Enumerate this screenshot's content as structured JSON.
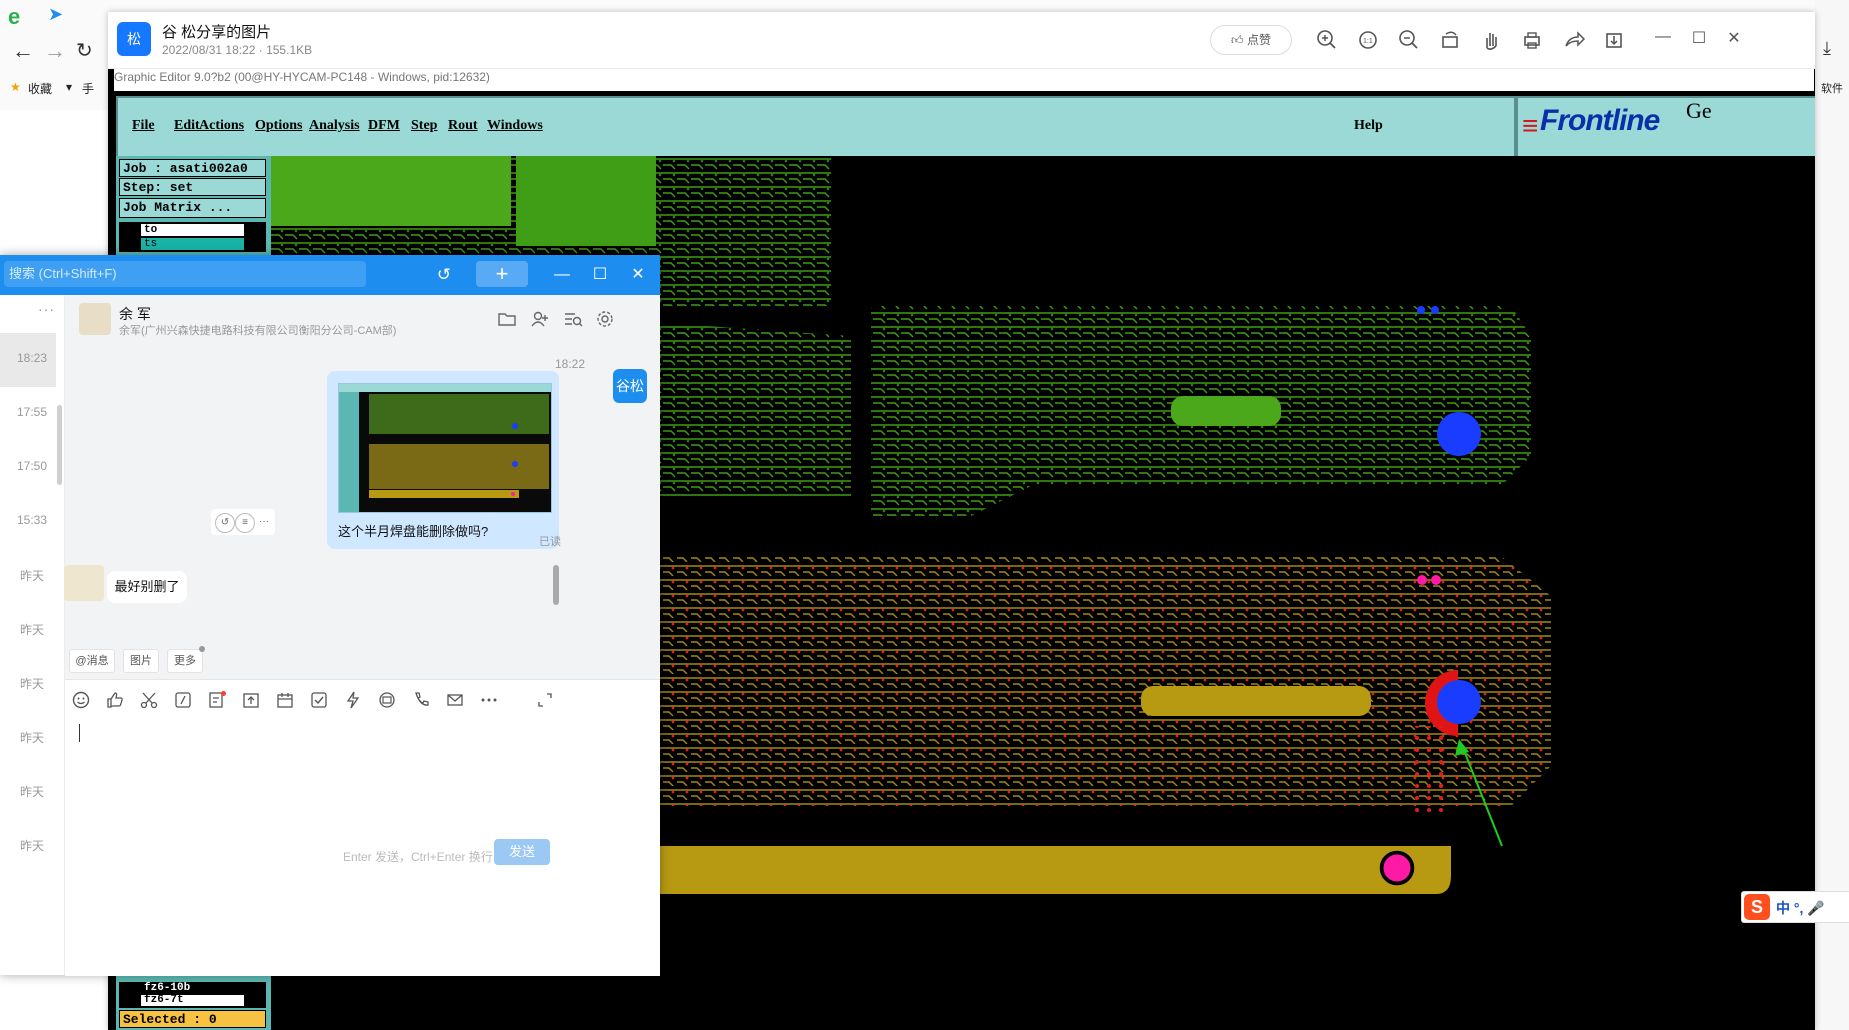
{
  "browser": {
    "bookmark_favorites": "收藏",
    "bookmark_mobile": "手",
    "right_label": "软件"
  },
  "viewer": {
    "avatar_char": "松",
    "title": "谷 松分享的图片",
    "subtitle": "2022/08/31 18:22 · 155.1KB",
    "like_label": "点赞",
    "tools": [
      "zoom-in-icon",
      "fit-icon",
      "zoom-out-icon",
      "rotate-icon",
      "hand-icon",
      "print-icon",
      "share-icon",
      "download-icon"
    ]
  },
  "cam": {
    "caption": "Graphic Editor 9.0?b2 (00@HY-HYCAM-PC148 - Windows, pid:12632)",
    "menus": [
      "File",
      "Edit",
      "Actions",
      "Options",
      "Analysis",
      "DFM",
      "Step",
      "Rout",
      "Windows"
    ],
    "help": "Help",
    "logo_text": "Frontline",
    "logo_ge": "Ge",
    "job": "Job : asati002a0",
    "step": "Step: set",
    "job_matrix": "Job Matrix ...",
    "layers_top": [
      "to",
      "ts"
    ],
    "layers_bottom": [
      "fz6-10b",
      "fz6-7t"
    ],
    "selected": "Selected : 0"
  },
  "chat": {
    "search_placeholder": "搜索 (Ctrl+Shift+F)",
    "session_times": [
      "18:23",
      "17:55",
      "17:50",
      "15:33",
      "昨天",
      "昨天",
      "昨天",
      "昨天",
      "昨天",
      "昨天"
    ],
    "contact_name": "余 军",
    "contact_sub": "余军(广州兴森快捷电路科技有限公司衡阳分公司-CAM部)",
    "msg_time": "18:22",
    "my_avatar": "谷松",
    "sent_text": "这个半月焊盘能删除做吗?",
    "read_status": "已读",
    "reply_text": "最好别删了",
    "chips": [
      "@消息",
      "图片",
      "更多"
    ],
    "send_hint": "Enter 发送，Ctrl+Enter 换行",
    "send_label": "发送"
  },
  "ime": {
    "label": "中 °, 🎤"
  }
}
